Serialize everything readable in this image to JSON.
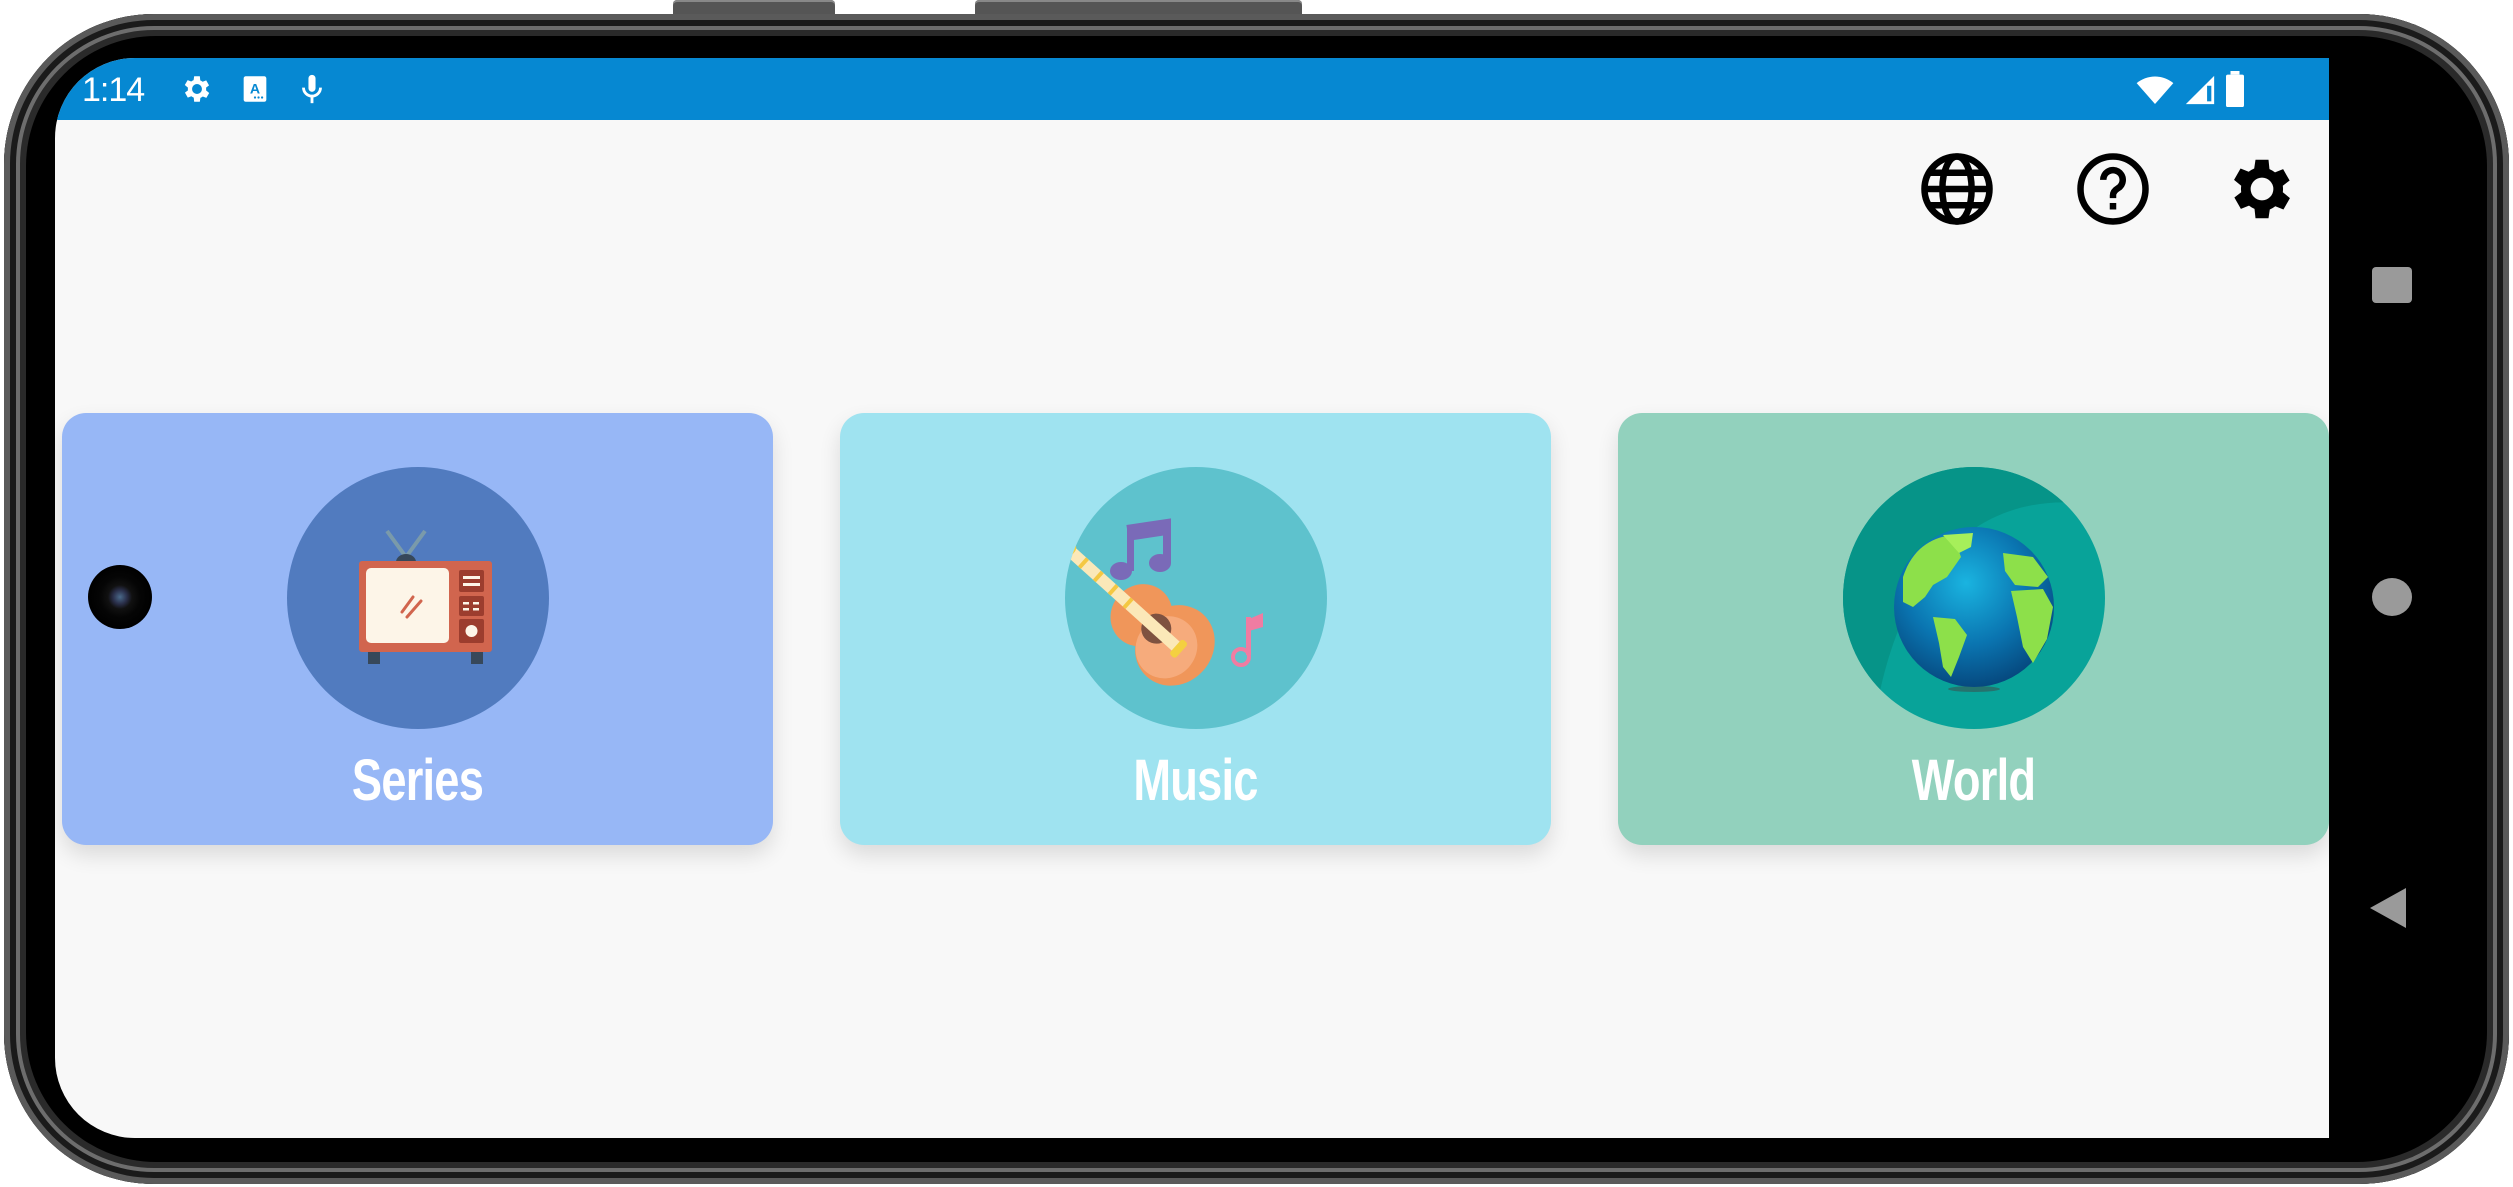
{
  "status_bar": {
    "time": "1:14",
    "left_icons": [
      "settings-icon",
      "accessibility-text-icon",
      "microphone-icon"
    ],
    "right_icons": [
      "wifi-icon",
      "signal-icon",
      "battery-icon"
    ],
    "color": "#0688d2"
  },
  "toolbar": {
    "icons": [
      {
        "name": "language-globe-icon",
        "label": "Language"
      },
      {
        "name": "help-icon",
        "label": "Help"
      },
      {
        "name": "settings-icon",
        "label": "Settings"
      }
    ]
  },
  "categories": [
    {
      "id": "series",
      "label": "Series",
      "icon": "tv-icon",
      "card_color": "#97b7f6",
      "circle_color": "#517bbf"
    },
    {
      "id": "music",
      "label": "Music",
      "icon": "guitar-icon",
      "card_color": "#9fe3f0",
      "circle_color": "#5ec2cd"
    },
    {
      "id": "world",
      "label": "World",
      "icon": "globe-earth-icon",
      "card_color": "#92d1bd",
      "circle_color": "#08a399"
    }
  ],
  "nav_bar": {
    "buttons": [
      "recents-button",
      "home-button",
      "back-button"
    ]
  }
}
